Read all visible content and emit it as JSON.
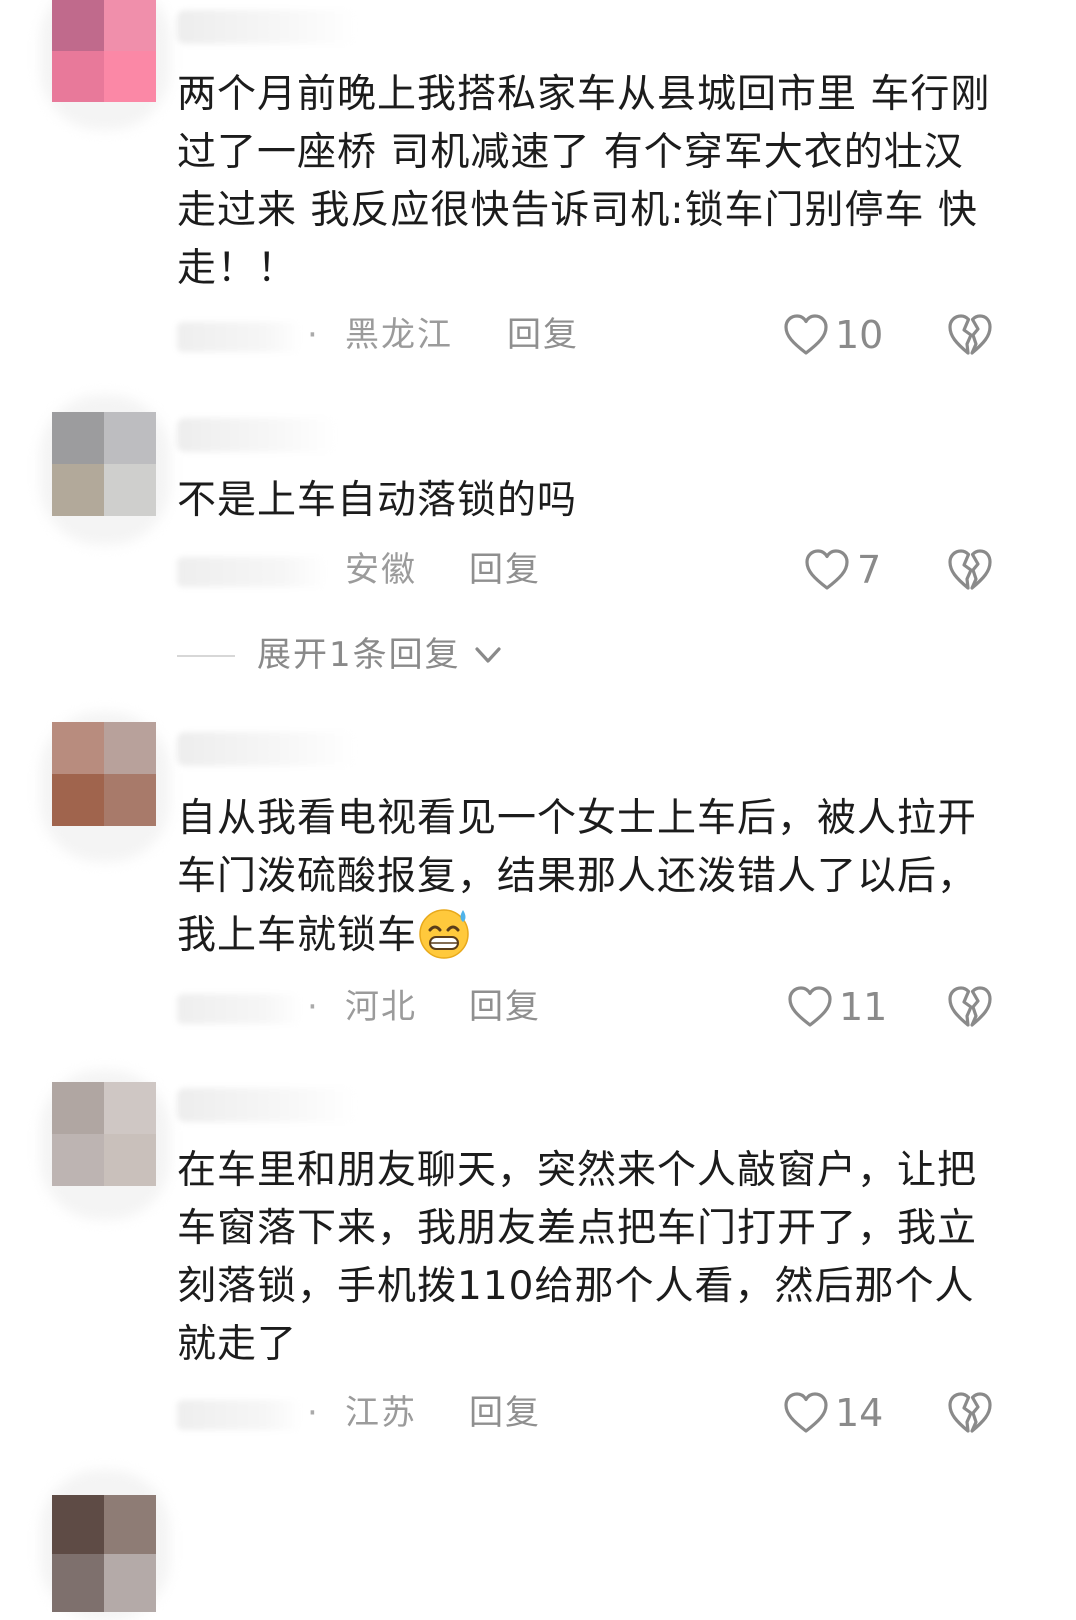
{
  "comments": [
    {
      "text": "两个月前晚上我搭私家车从县城回市里 车行刚过了一座桥 司机减速了 有个穿军大衣的壮汉走过来 我反应很快告诉司机:锁车门别停车 快走！！",
      "location": "黑龙江",
      "reply_label": "回复",
      "likes": "10",
      "avatar_colors": [
        "#c06a8c",
        "#f08fab",
        "#e8799a",
        "#fb88a6"
      ]
    },
    {
      "text": "不是上车自动落锁的吗",
      "location": "安徽",
      "reply_label": "回复",
      "likes": "7",
      "expand_label": "展开1条回复",
      "avatar_colors": [
        "#9c9c9e",
        "#bdbdc0",
        "#b2a99a",
        "#cfcfcd"
      ]
    },
    {
      "text": "自从我看电视看见一个女士上车后，被人拉开车门泼硫酸报复，结果那人还泼错人了以后，我上车就锁车",
      "emoji": "grinning-sweat-emoji",
      "location": "河北",
      "reply_label": "回复",
      "likes": "11",
      "avatar_colors": [
        "#b88c7e",
        "#b8a19b",
        "#a0644d",
        "#a87a6a"
      ]
    },
    {
      "text": "在车里和朋友聊天，突然来个人敲窗户，让把车窗落下来，我朋友差点把车门打开了，我立刻落锁，手机拨110给那个人看，然后那个人就走了",
      "location": "江苏",
      "reply_label": "回复",
      "likes": "14",
      "avatar_colors": [
        "#b0a6a2",
        "#cfc7c4",
        "#bdb4b2",
        "#c9c0bb"
      ]
    }
  ],
  "partial_avatar_colors": [
    "#5e4b45",
    "#8e7c75",
    "#7e706d",
    "#b4aaa8"
  ],
  "icons": {
    "like": "heart-outline-icon",
    "dislike": "broken-heart-icon",
    "expand": "chevron-down-icon"
  },
  "colors": {
    "text": "#1c1c1c",
    "meta": "#9b9b9b",
    "icon": "#8a8a8a"
  }
}
